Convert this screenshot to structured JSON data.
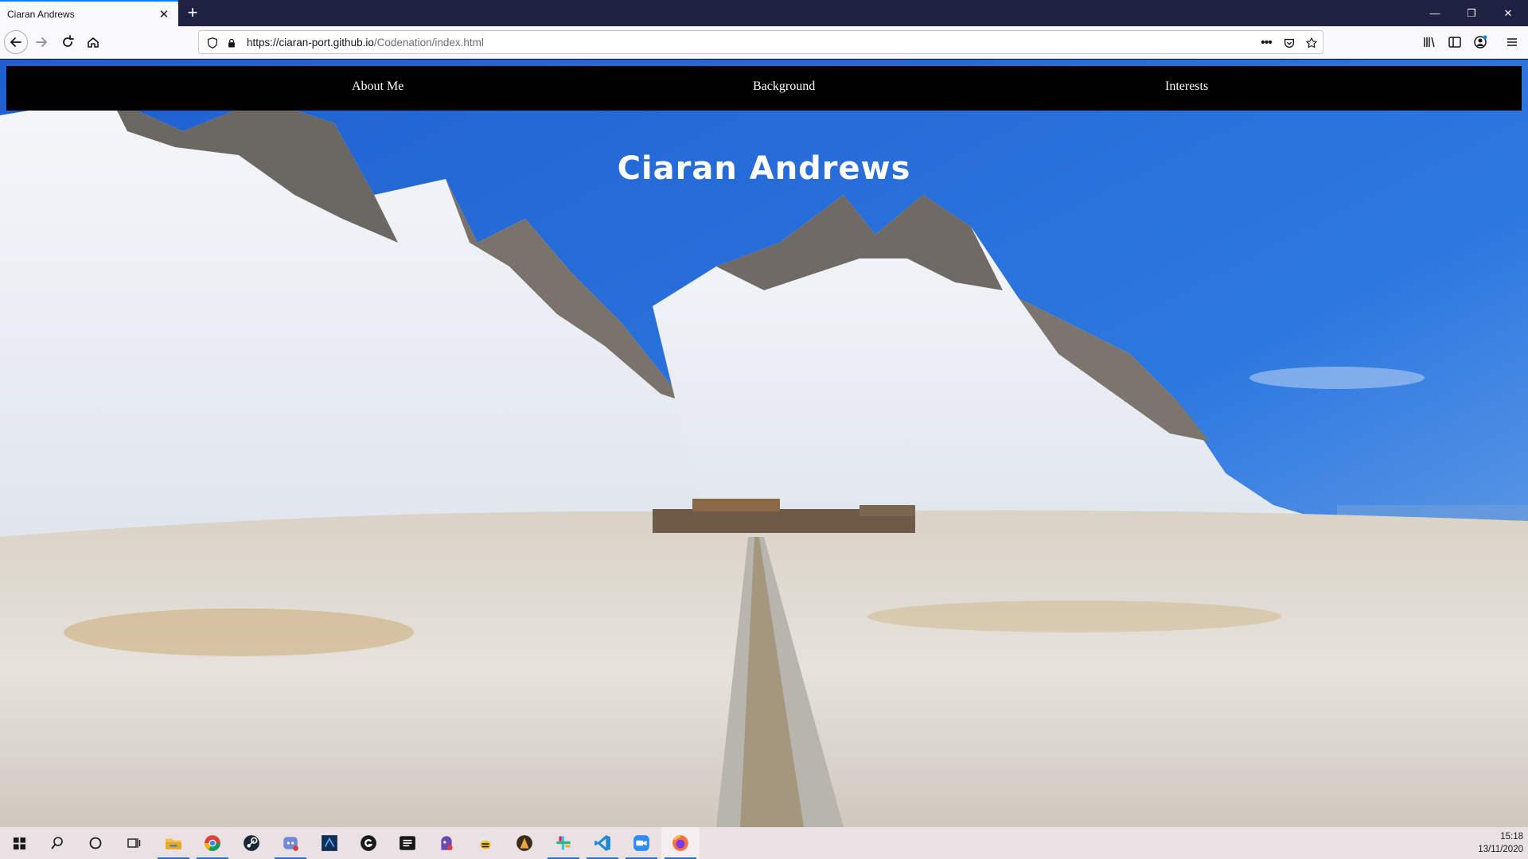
{
  "browser": {
    "tab_title": "Ciaran Andrews",
    "tab_close_icon": "close-icon",
    "new_tab_icon": "plus-icon",
    "url_host": "https://ciaran-port.github.io",
    "url_path": "/Codenation/index.html",
    "window_controls": [
      "minimize-icon",
      "restore-icon",
      "close-icon"
    ]
  },
  "page": {
    "nav": [
      "About Me",
      "Background",
      "Interests"
    ],
    "title": "Ciaran Andrews"
  },
  "taskbar": {
    "icons": [
      "windows-start-icon",
      "search-icon",
      "cortana-icon",
      "task-view-icon",
      "file-explorer-icon",
      "chrome-icon",
      "steam-icon",
      "discord-icon",
      "ide-icon",
      "github-icon",
      "notes-icon",
      "app-icon",
      "bee-icon",
      "game-icon",
      "slack-icon",
      "vscode-icon",
      "zoom-icon",
      "firefox-icon"
    ],
    "time": "15:18",
    "date": "13/11/2020"
  },
  "colors": {
    "sky": "#2f6fd6",
    "navbar": "#000000",
    "tab_accent": "#0a84ff",
    "titlebar": "#1f2142"
  }
}
